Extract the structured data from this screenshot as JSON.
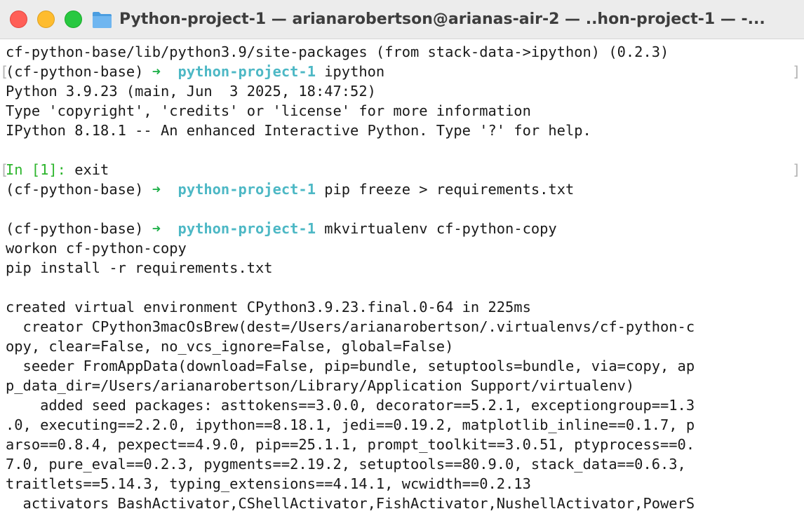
{
  "window": {
    "title": "Python-project-1 — arianarobertson@arianas-air-2 — ..hon-project-1 — -..."
  },
  "colors": {
    "prompt_arrow": "#22b14c",
    "directory": "#4db8c5",
    "ipython_prompt": "#2db52d"
  },
  "terminal": {
    "marker": "[",
    "right_marker": "]",
    "arrow": "➜",
    "env": "(cf-python-base) ",
    "dir": "python-project-1",
    "lines": {
      "l0": "cf-python-base/lib/python3.9/site-packages (from stack-data->ipython) (0.2.3)",
      "l1_cmd": " ipython",
      "l2": "Python 3.9.23 (main, Jun  3 2025, 18:47:52)",
      "l3": "Type 'copyright', 'credits' or 'license' for more information",
      "l4": "IPython 8.18.1 -- An enhanced Interactive Python. Type '?' for help.",
      "l6_prompt": "In [1]: ",
      "l6_cmd": "exit",
      "l7_cmd": " pip freeze > requirements.txt",
      "l9_cmd": " mkvirtualenv cf-python-copy",
      "l10": "workon cf-python-copy",
      "l11": "pip install -r requirements.txt",
      "l13": "created virtual environment CPython3.9.23.final.0-64 in 225ms",
      "l14": "  creator CPython3macOsBrew(dest=/Users/arianarobertson/.virtualenvs/cf-python-c",
      "l15": "opy, clear=False, no_vcs_ignore=False, global=False)",
      "l16": "  seeder FromAppData(download=False, pip=bundle, setuptools=bundle, via=copy, ap",
      "l17": "p_data_dir=/Users/arianarobertson/Library/Application Support/virtualenv)",
      "l18": "    added seed packages: asttokens==3.0.0, decorator==5.2.1, exceptiongroup==1.3",
      "l19": ".0, executing==2.2.0, ipython==8.18.1, jedi==0.19.2, matplotlib_inline==0.1.7, p",
      "l20": "arso==0.8.4, pexpect==4.9.0, pip==25.1.1, prompt_toolkit==3.0.51, ptyprocess==0.",
      "l21": "7.0, pure_eval==0.2.3, pygments==2.19.2, setuptools==80.9.0, stack_data==0.6.3,",
      "l22": "traitlets==5.14.3, typing_extensions==4.14.1, wcwidth==0.2.13",
      "l23": "  activators BashActivator,CShellActivator,FishActivator,NushellActivator,PowerS"
    }
  }
}
